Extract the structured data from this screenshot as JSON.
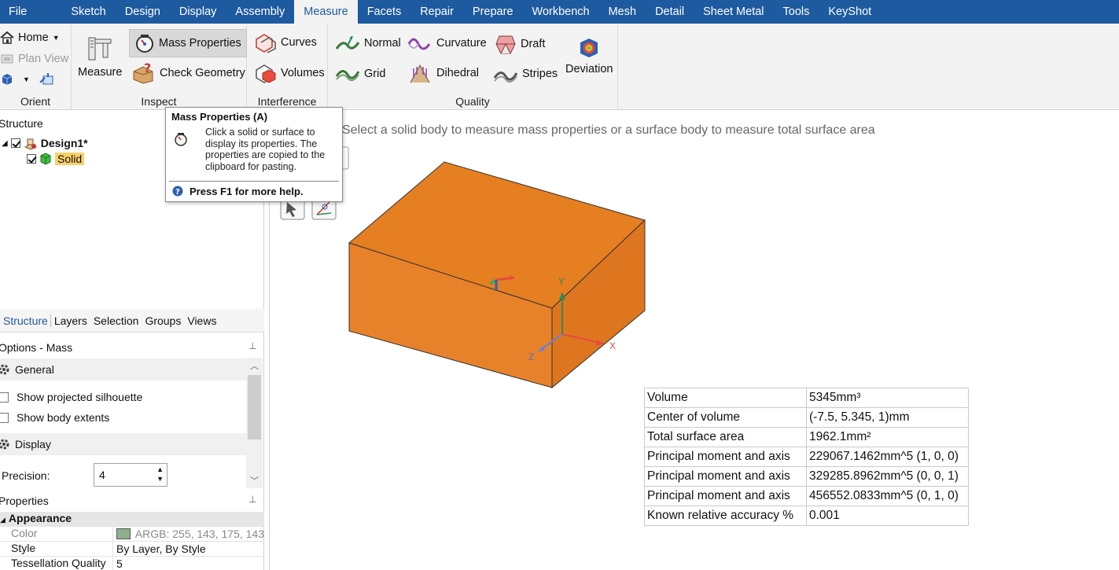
{
  "menu": {
    "tabs": [
      "File",
      "Sketch",
      "Design",
      "Display",
      "Assembly",
      "Measure",
      "Facets",
      "Repair",
      "Prepare",
      "Workbench",
      "Mesh",
      "Detail",
      "Sheet Metal",
      "Tools",
      "KeyShot"
    ],
    "active": "Measure"
  },
  "ribbon": {
    "orient": {
      "label": "Orient",
      "home": "Home",
      "plan_view": "Plan View"
    },
    "inspect": {
      "label": "Inspect",
      "measure": "Measure",
      "mass_properties": "Mass Properties",
      "check_geometry": "Check Geometry"
    },
    "interference": {
      "label": "Interference",
      "curves": "Curves",
      "volumes": "Volumes"
    },
    "quality": {
      "label": "Quality",
      "normal": "Normal",
      "grid": "Grid",
      "curvature": "Curvature",
      "dihedral": "Dihedral",
      "draft": "Draft",
      "stripes": "Stripes",
      "deviation": "Deviation"
    }
  },
  "tooltip": {
    "title": "Mass Properties  (A)",
    "body": "Click a solid or surface to display its properties. The properties are copied to the clipboard for pasting.",
    "help": "Press F1 for more help."
  },
  "structure": {
    "title": "Structure",
    "root": "Design1*",
    "child": "Solid",
    "tabs": [
      "Structure",
      "Layers",
      "Selection",
      "Groups",
      "Views"
    ]
  },
  "options": {
    "title": "Options - Mass",
    "general": "General",
    "show_projected_silhouette": "Show projected silhouette",
    "show_body_extents": "Show body extents",
    "display": "Display",
    "precision_label": "Precision:",
    "precision_value": "4"
  },
  "properties": {
    "title": "Properties",
    "appearance": "Appearance",
    "rows": [
      {
        "key": "Color",
        "value": "ARGB: 255, 143, 175, 143"
      },
      {
        "key": "Style",
        "value": "By Layer, By Style"
      },
      {
        "key": "Tessellation Quality",
        "value": "5"
      }
    ],
    "swatch_color": "#8faf8f"
  },
  "viewport": {
    "hint": "Select a solid body to measure mass properties or a surface body to measure total surface area",
    "axis_x": "X",
    "axis_y": "Y",
    "axis_z": "Z",
    "body_color": "#e67e22"
  },
  "results": [
    {
      "key": "Volume",
      "value": "5345mm³"
    },
    {
      "key": "Center of volume",
      "value": "(-7.5, 5.345, 1)mm"
    },
    {
      "key": "Total surface area",
      "value": "1962.1mm²"
    },
    {
      "key": "Principal moment and axis",
      "value": "229067.1462mm^5 (1, 0, 0)"
    },
    {
      "key": "Principal moment and axis",
      "value": "329285.8962mm^5 (0, 0, 1)"
    },
    {
      "key": "Principal moment and axis",
      "value": "456552.0833mm^5 (0, 1, 0)"
    },
    {
      "key": "Known relative accuracy %",
      "value": "0.001"
    }
  ]
}
